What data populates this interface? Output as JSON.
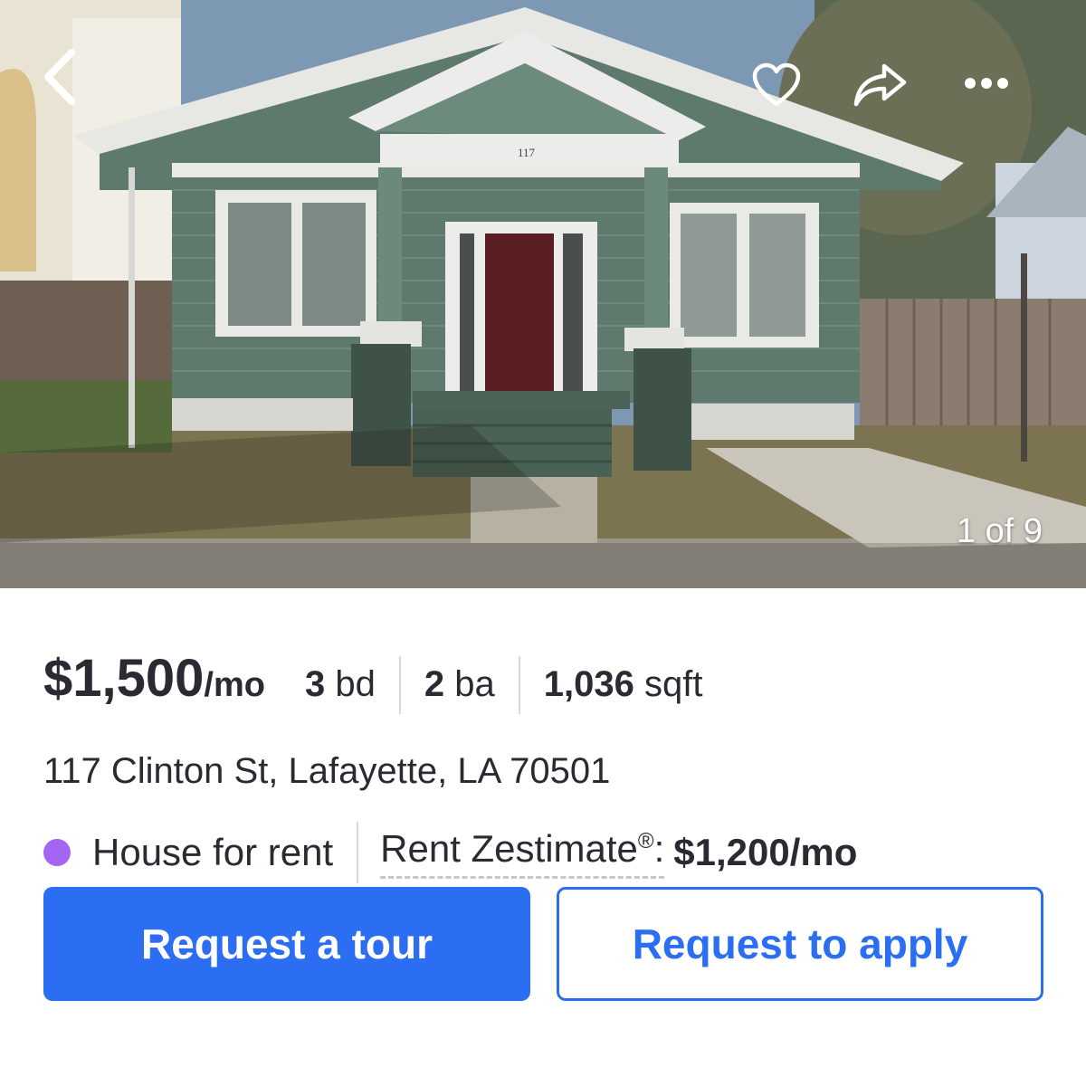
{
  "photo": {
    "house_number": "117",
    "counter": "1 of 9"
  },
  "icons": {
    "back": "chevron-left-icon",
    "favorite": "heart-icon",
    "share": "share-arrow-icon",
    "more": "more-dots-icon"
  },
  "listing": {
    "price": "$1,500",
    "price_unit": "/mo",
    "beds": "3",
    "beds_label": "bd",
    "baths": "2",
    "baths_label": "ba",
    "sqft": "1,036",
    "sqft_label": "sqft",
    "address": "117 Clinton St, Lafayette, LA 70501",
    "type": "House for rent",
    "zestimate_label": "Rent Zestimate",
    "zestimate_mark": "®",
    "zestimate_colon": ":",
    "zestimate_value": "$1,200/mo"
  },
  "actions": {
    "tour": "Request a tour",
    "apply": "Request to apply"
  },
  "colors": {
    "accent": "#2c6ef2",
    "status_dot": "#a365f3"
  }
}
